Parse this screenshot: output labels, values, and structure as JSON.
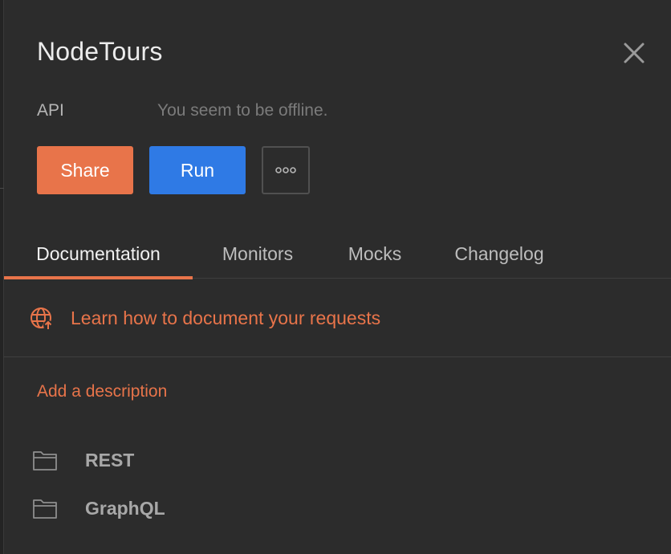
{
  "header": {
    "title": "NodeTours",
    "close_icon": "close-icon"
  },
  "meta": {
    "label": "API",
    "status": "You seem to be offline."
  },
  "actions": {
    "share_label": "Share",
    "run_label": "Run",
    "more_label": "∘∘∘",
    "share_color": "#e8744a",
    "run_color": "#2f7ae5"
  },
  "tabs": [
    {
      "label": "Documentation",
      "active": true
    },
    {
      "label": "Monitors",
      "active": false
    },
    {
      "label": "Mocks",
      "active": false
    },
    {
      "label": "Changelog",
      "active": false
    }
  ],
  "docs": {
    "learn_icon": "globe-icon",
    "learn_link": "Learn how to document your requests",
    "add_description": "Add a description"
  },
  "folders": [
    {
      "icon": "folder-icon",
      "label": "REST"
    },
    {
      "icon": "folder-icon",
      "label": "GraphQL"
    }
  ],
  "colors": {
    "background": "#2c2c2c",
    "accent": "#e8744a",
    "primary": "#2f7ae5"
  }
}
